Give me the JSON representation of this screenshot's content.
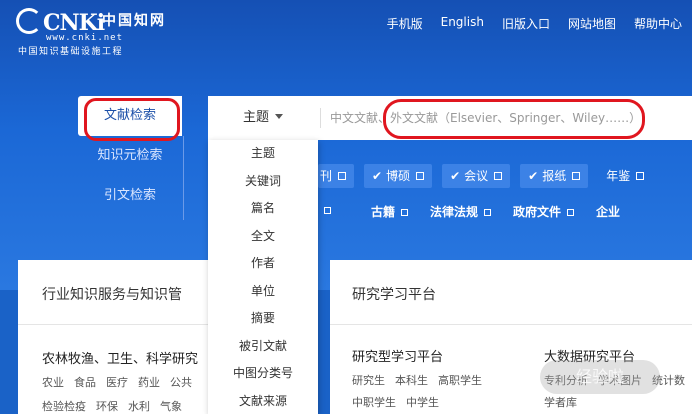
{
  "logo": {
    "brand": "CNKi",
    "brand_cn": "中国知网",
    "url": "www.cnki.net",
    "tagline": "中国知识基础设施工程"
  },
  "topnav": [
    "手机版",
    "English",
    "旧版入口",
    "网站地图",
    "帮助中心"
  ],
  "tabs": [
    "文献检索",
    "知识元检索",
    "引文检索"
  ],
  "search": {
    "field": "主题",
    "placeholder": "中文文献、外文文献（Elsevier、Springer、Wiley……）"
  },
  "field_options": [
    "主题",
    "关键词",
    "篇名",
    "全文",
    "作者",
    "单位",
    "摘要",
    "被引文献",
    "中图分类号",
    "文献来源"
  ],
  "resource_checks": [
    "刊",
    "博硕",
    "会议",
    "报纸",
    "年鉴"
  ],
  "resource_links": [
    "古籍",
    "法律法规",
    "政府文件",
    "企业"
  ],
  "cards": {
    "industry": {
      "title": "行业知识服务与知识管",
      "heading": "农林牧渔、卫生、科学研究",
      "row1": [
        "农业",
        "食品",
        "医疗",
        "药业",
        "公共"
      ],
      "row2": [
        "检验检疫",
        "环保",
        "水利",
        "气象"
      ]
    },
    "research": {
      "title": "研究学习平台",
      "left_heading": "研究型学习平台",
      "left_row1": [
        "研究生",
        "本科生",
        "高职学生"
      ],
      "left_row2": [
        "中职学生",
        "中学生"
      ],
      "right_heading": "大数据研究平台",
      "right_row1": [
        "专利分析",
        "学术图片",
        "统计数"
      ],
      "right_row2": [
        "学者库"
      ]
    }
  },
  "watermark": "经验啦"
}
